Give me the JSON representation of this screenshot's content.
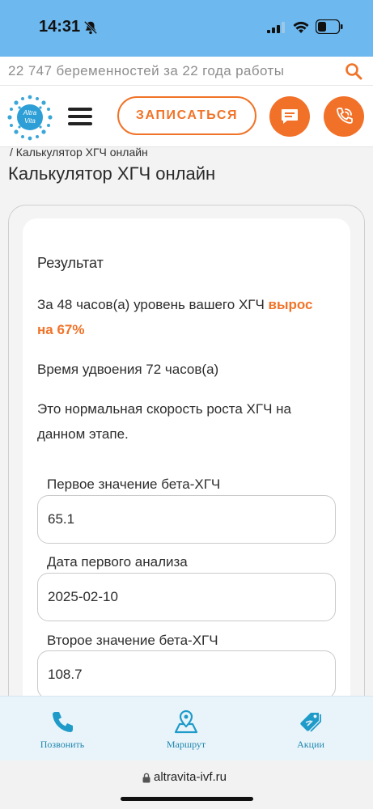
{
  "status_bar": {
    "time": "14:31"
  },
  "search": {
    "text": "22 747 беременностей за 22 года работы"
  },
  "header": {
    "logo_text_top": "Altra",
    "logo_text_bottom": "Vita",
    "signup_label": "ЗАПИСАТЬСЯ"
  },
  "breadcrumb": "/ Калькулятор ХГЧ онлайн",
  "page_title": "Калькулятор ХГЧ онлайн",
  "result": {
    "heading": "Результат",
    "line1_prefix": "За 48 часов(а) уровень вашего ХГЧ ",
    "line1_accent": "вырос на 67%",
    "line2": "Время удвоения 72 часов(а)",
    "line3": "Это нормальная скорость роста ХГЧ на данном этапе."
  },
  "form": {
    "first_value_label": "Первое значение бета-ХГЧ",
    "first_value": "65.1",
    "first_date_label": "Дата первого анализа",
    "first_date": "2025-02-10",
    "second_value_label": "Второе значение бета-ХГЧ",
    "second_value": "108.7"
  },
  "tabbar": {
    "call_label": "Позвонить",
    "route_label": "Маршрут",
    "promo_label": "Акции"
  },
  "url": {
    "domain": "altravita-ivf.ru"
  },
  "colors": {
    "accent": "#f07328",
    "tab_blue": "#1f86ad",
    "status_bg": "#6db8ee"
  },
  "icons": [
    "bell-off-icon",
    "signal-icon",
    "wifi-icon",
    "battery-icon",
    "search-icon",
    "menu-icon",
    "chat-icon",
    "phone-icon",
    "map-pin-icon",
    "tag-icon",
    "lock-icon"
  ]
}
